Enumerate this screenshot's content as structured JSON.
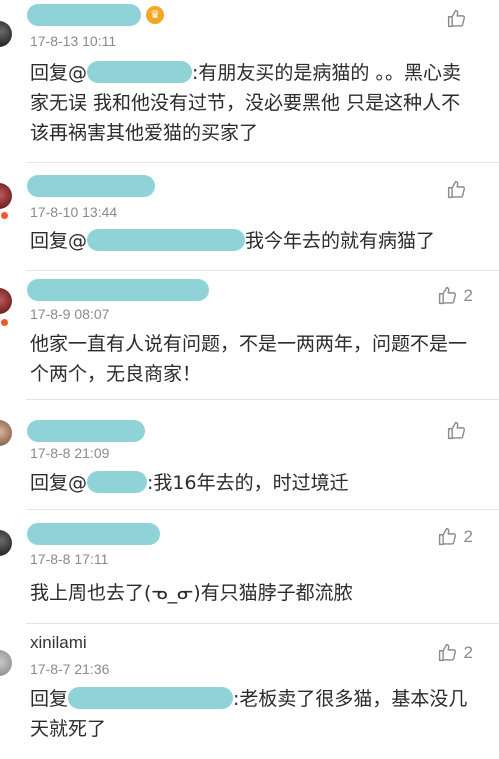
{
  "like_icon": "thumbs-up-icon",
  "mask_color": "#8fd3d9",
  "comments": [
    {
      "time": "17-8-13 10:11",
      "likes": "",
      "reply_prefix": "回复@",
      "text": ":有朋友买的是病猫的 。。黑心卖家无误 我和他没有过节，没必要黑他 只是这种人不该再祸害其他爱猫的买家了"
    },
    {
      "time": "17-8-10 13:44",
      "likes": "",
      "reply_prefix": "回复@",
      "text": "我今年去的就有病猫了"
    },
    {
      "time": "17-8-9 08:07",
      "likes": "2",
      "text": "他家一直有人说有问题，不是一两两年，问题不是一个两个，无良商家！"
    },
    {
      "time": "17-8-8 21:09",
      "likes": "",
      "reply_prefix": "回复@",
      "text": ":我16年去的，时过境迁"
    },
    {
      "time": "17-8-8 17:11",
      "likes": "2",
      "text": "我上周也去了(ᓀ_ᓂ)有只猫脖子都流脓"
    },
    {
      "username": "xinilami",
      "time": "17-8-7 21:36",
      "likes": "2",
      "reply_prefix": "回复",
      "text": ":老板卖了很多猫，基本没几天就死了"
    }
  ]
}
